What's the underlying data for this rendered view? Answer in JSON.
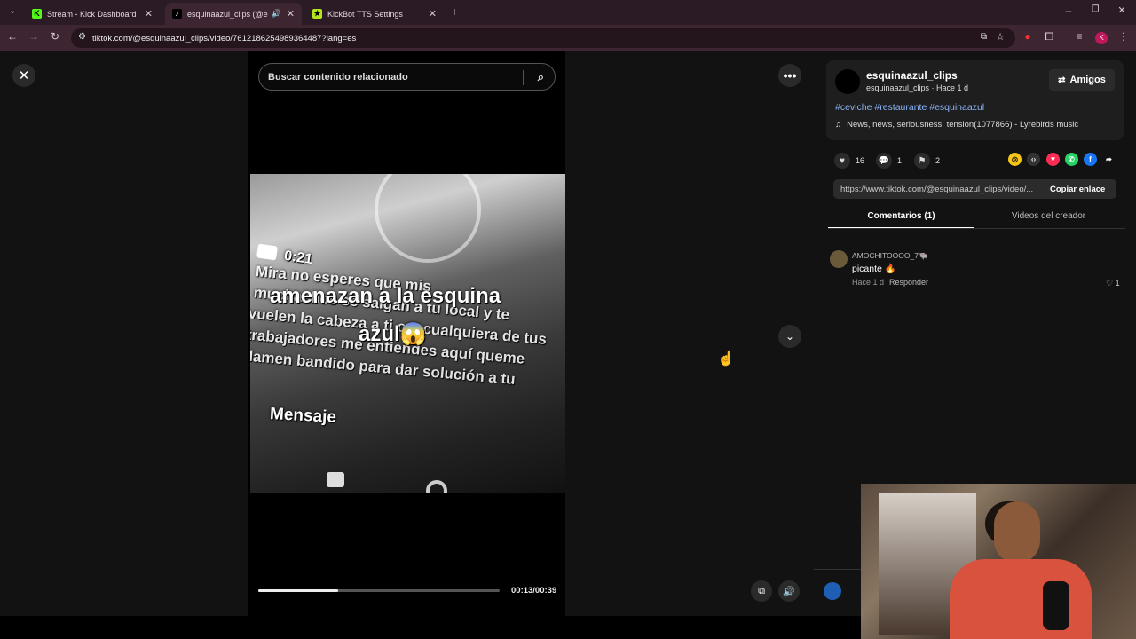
{
  "tabs": [
    {
      "title": "Stream - Kick Dashboard",
      "icon": "kick-icon",
      "active": false
    },
    {
      "title": "esquinaazul_clips (@esquin",
      "icon": "tiktok-icon",
      "active": true
    },
    {
      "title": "KickBot TTS Settings",
      "icon": "kickbot-icon",
      "active": false
    }
  ],
  "address": {
    "url": "tiktok.com/@esquinaazul_clips/video/7612186254989364487?lang=es"
  },
  "search": {
    "placeholder": "Buscar contenido relacionado"
  },
  "video": {
    "caption_line1": "amenazan a la esquina",
    "caption_line2": "azul😱",
    "rec_time": "0:21",
    "bg_text": [
      "Mira no esperes que mis",
      "muchachos se salgan a tu local y te",
      "vuelen la cabeza a ti o a cualquiera de tus",
      "trabajadores me entiendes aquí queme",
      "llamen bandido para dar solución a tu"
    ],
    "message_label": "Mensaje",
    "time_display": "00:13/00:39",
    "progress_fraction": 0.33
  },
  "author": {
    "username": "esquinaazul_clips",
    "subline": "esquinaazul_clips · Hace 1 d",
    "friends_button": "Amigos",
    "hashtags": "#ceviche #restaurante #esquinaazul",
    "music": "News, news, seriousness, tension(1077866) - Lyrebirds music"
  },
  "stats": {
    "likes": "16",
    "comments": "1",
    "saves": "2"
  },
  "share": {
    "link": "https://www.tiktok.com/@esquinaazul_clips/video/...",
    "copy_button": "Copiar enlace"
  },
  "comment_tabs": {
    "comments": "Comentarios (1)",
    "creator_videos": "Videos del creador"
  },
  "comments": [
    {
      "user": "AMOCHITOOOO_7🐃",
      "text": "picante 🔥",
      "time": "Hace 1 d",
      "reply": "Responder",
      "likes": "1"
    }
  ],
  "colors": {
    "hashtag": "#8ab4f8",
    "accent": "#fe2c55",
    "tab_bar": "#2b1b24",
    "toolbar": "#3d2631"
  }
}
